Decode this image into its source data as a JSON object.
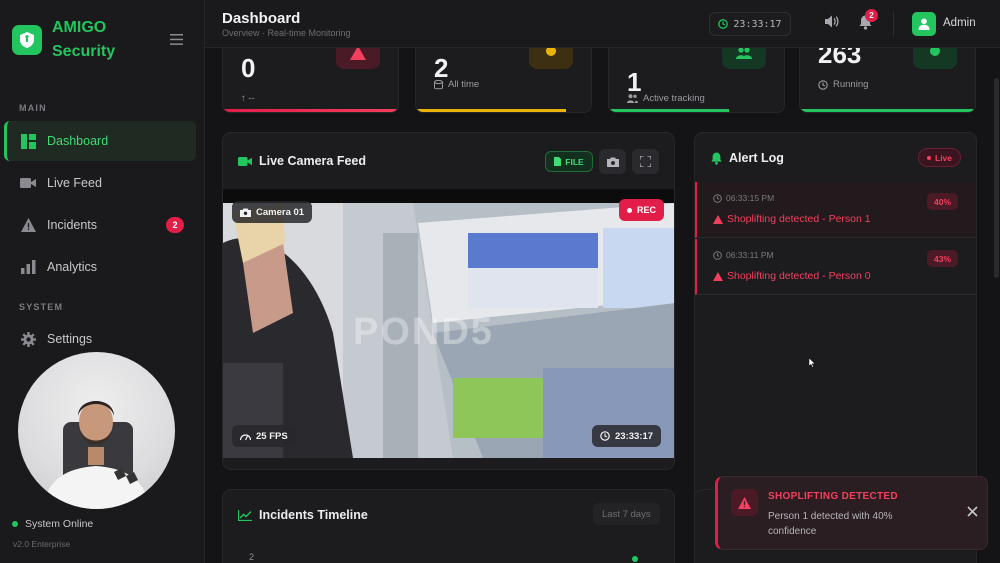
{
  "brand": {
    "name_line1": "AMIGO",
    "name_line2": "Security"
  },
  "sidebar": {
    "main_label": "MAIN",
    "system_label": "SYSTEM",
    "items": [
      {
        "label": "Dashboard",
        "icon": "dashboard-icon",
        "active": true
      },
      {
        "label": "Live Feed",
        "icon": "video-icon"
      },
      {
        "label": "Incidents",
        "icon": "warning-icon",
        "badge": "2"
      },
      {
        "label": "Analytics",
        "icon": "bar-chart-icon"
      },
      {
        "label": "Settings",
        "icon": "gear-icon"
      }
    ],
    "status": "System Online",
    "version": "v2.0 Enterprise"
  },
  "header": {
    "title": "Dashboard",
    "subtitle": "Overview · Real-time Monitoring",
    "clock": "23:33:17",
    "notification_count": "2",
    "user": "Admin"
  },
  "stats": [
    {
      "value": "0",
      "sub": "↑ --",
      "accent": "#e11d48"
    },
    {
      "value": "2",
      "sub": "All time",
      "accent": "#eab308"
    },
    {
      "value": "1",
      "sub": "Active tracking",
      "accent": "#22c55e"
    },
    {
      "value": "263",
      "sub": "Running",
      "accent": "#22c55e"
    }
  ],
  "camera": {
    "title": "Live Camera Feed",
    "file_button": "FILE",
    "camera_name": "Camera 01",
    "rec": "REC",
    "watermark": "POND5",
    "fps": "25 FPS",
    "timestamp": "23:33:17"
  },
  "alerts": {
    "title": "Alert Log",
    "live": "Live",
    "items": [
      {
        "time": "06:33:15 PM",
        "message": "Shoplifting detected - Person 1",
        "confidence": "40%"
      },
      {
        "time": "06:33:11 PM",
        "message": "Shoplifting detected - Person 0",
        "confidence": "43%"
      }
    ]
  },
  "timeline": {
    "title": "Incidents Timeline",
    "range": "Last 7 days",
    "y_tick": "2"
  },
  "toast": {
    "title": "SHOPLIFTING DETECTED",
    "body": "Person 1 detected with 40% confidence"
  },
  "colors": {
    "accent": "#22c55e",
    "danger": "#e11d48",
    "warning": "#eab308"
  }
}
